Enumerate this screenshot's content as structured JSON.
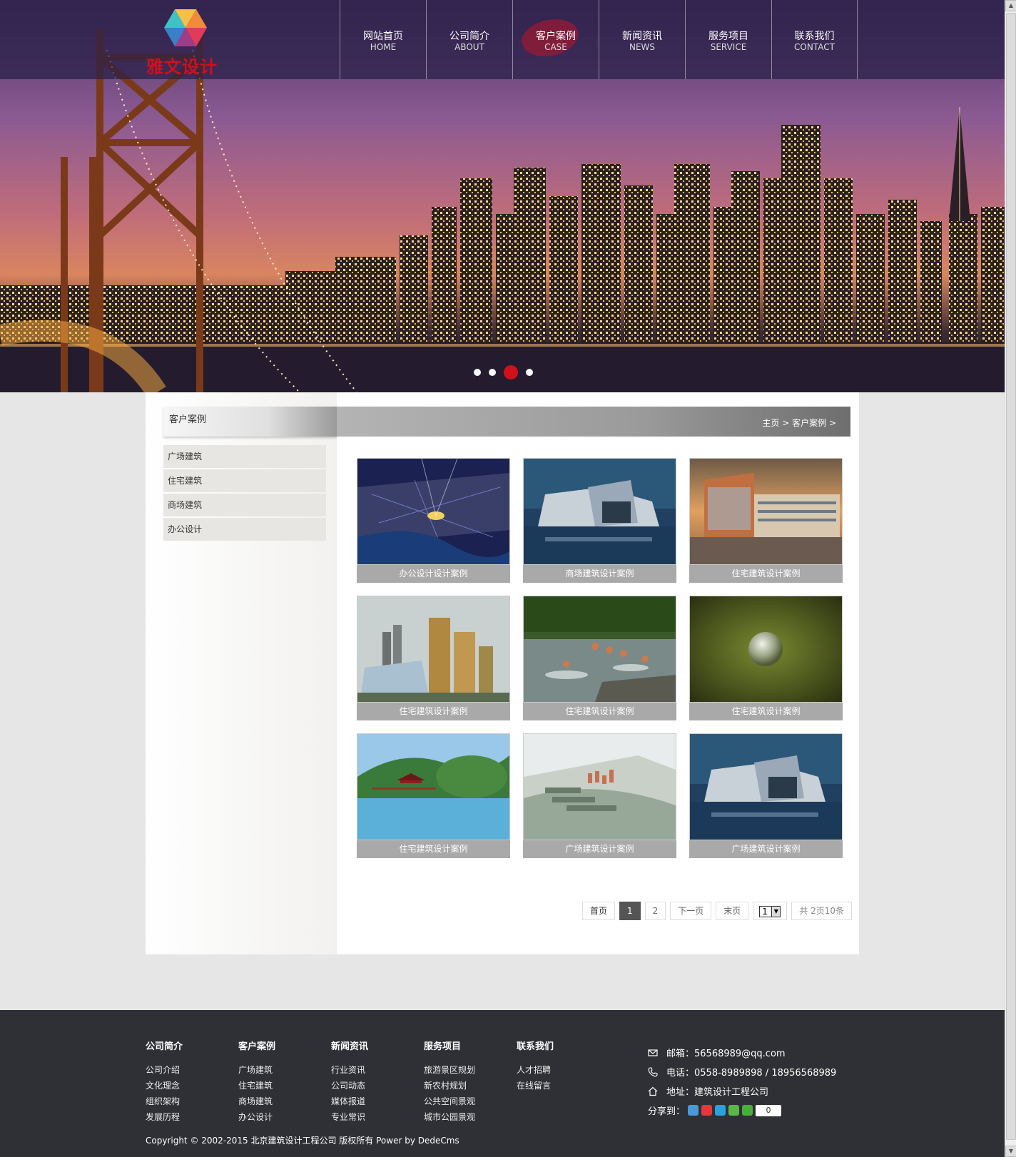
{
  "brand": {
    "name": "雅文设计"
  },
  "nav": [
    {
      "cn": "网站首页",
      "en": "HOME"
    },
    {
      "cn": "公司简介",
      "en": "ABOUT"
    },
    {
      "cn": "客户案例",
      "en": "CASE",
      "active": true
    },
    {
      "cn": "新闻资讯",
      "en": "NEWS"
    },
    {
      "cn": "服务项目",
      "en": "SERVICE"
    },
    {
      "cn": "联系我们",
      "en": "CONTACT"
    }
  ],
  "slider": {
    "count": 4,
    "active_index": 2
  },
  "sidebar": {
    "title": "客户案例",
    "items": [
      "广场建筑",
      "住宅建筑",
      "商场建筑",
      "办公设计"
    ]
  },
  "breadcrumb": {
    "home": "主页",
    "sep": ">",
    "current": "客户案例",
    "trail": ">"
  },
  "cases": [
    {
      "caption": "办公设计设计案例",
      "image": "night-city-aerial"
    },
    {
      "caption": "商场建筑设计案例",
      "image": "modern-building-water"
    },
    {
      "caption": "住宅建筑设计案例",
      "image": "sunset-building"
    },
    {
      "caption": "住宅建筑设计案例",
      "image": "high-rise-towers"
    },
    {
      "caption": "住宅建筑设计案例",
      "image": "kids-in-river"
    },
    {
      "caption": "住宅建筑设计案例",
      "image": "bubble-on-grass"
    },
    {
      "caption": "住宅建筑设计案例",
      "image": "lake-pavilion"
    },
    {
      "caption": "广场建筑设计案例",
      "image": "residential-aerial"
    },
    {
      "caption": "广场建筑设计案例",
      "image": "modern-building-water"
    }
  ],
  "pager": {
    "first": "首页",
    "pages": [
      "1",
      "2"
    ],
    "current": "1",
    "next": "下一页",
    "last": "末页",
    "select_value": "1",
    "info": "共 2页10条"
  },
  "footer": {
    "columns": [
      {
        "title": "公司简介",
        "links": [
          "公司介绍",
          "文化理念",
          "组织架构",
          "发展历程"
        ]
      },
      {
        "title": "客户案例",
        "links": [
          "广场建筑",
          "住宅建筑",
          "商场建筑",
          "办公设计"
        ]
      },
      {
        "title": "新闻资讯",
        "links": [
          "行业资讯",
          "公司动态",
          "媒体报道",
          "专业常识"
        ]
      },
      {
        "title": "服务项目",
        "links": [
          "旅游景区规划",
          "新农村规划",
          "公共空间景观",
          "城市公园景观"
        ]
      },
      {
        "title": "联系我们",
        "links": [
          "人才招聘",
          "在线留言"
        ]
      }
    ],
    "contact": {
      "email": "邮箱：56568989@qq.com",
      "phone": "电话：0558-8989898 / 18956568989",
      "address": "地址：建筑设计工程公司",
      "share_label": "分享到：",
      "share_count": "0"
    },
    "copyright": "Copyright © 2002-2015 北京建筑设计工程公司 版权所有 Power by DedeCms"
  },
  "colors": {
    "accent": "#d0101a",
    "footer_bg": "#2e3035",
    "caption_bg": "#a9a9a9"
  }
}
